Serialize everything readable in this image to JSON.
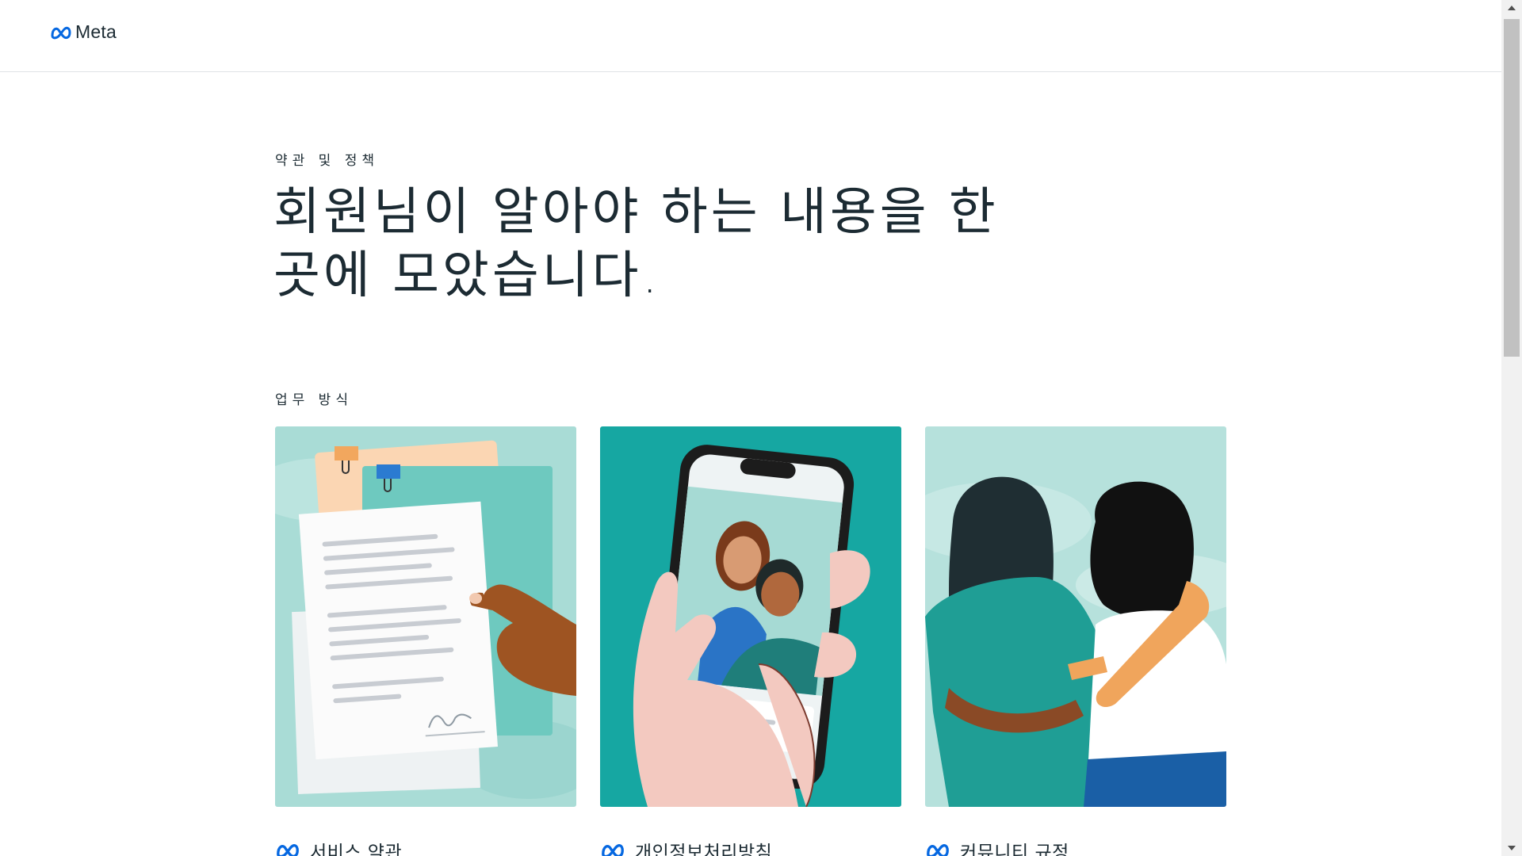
{
  "header": {
    "logo_text": "Meta"
  },
  "hero": {
    "eyebrow": "약관 및 정책",
    "title": "회원님이 알아야 하는 내용을 한 곳에 모았습니다."
  },
  "section": {
    "label": "업무 방식"
  },
  "cards": [
    {
      "title": "서비스 약관"
    },
    {
      "title": "개인정보처리방침"
    },
    {
      "title": "커뮤니티 규정"
    }
  ],
  "colors": {
    "meta_blue": "#0668e1",
    "text": "#1c2b33",
    "teal_light": "#a9dcd6",
    "teal": "#16a7a2",
    "pink": "#f3c9c0"
  }
}
